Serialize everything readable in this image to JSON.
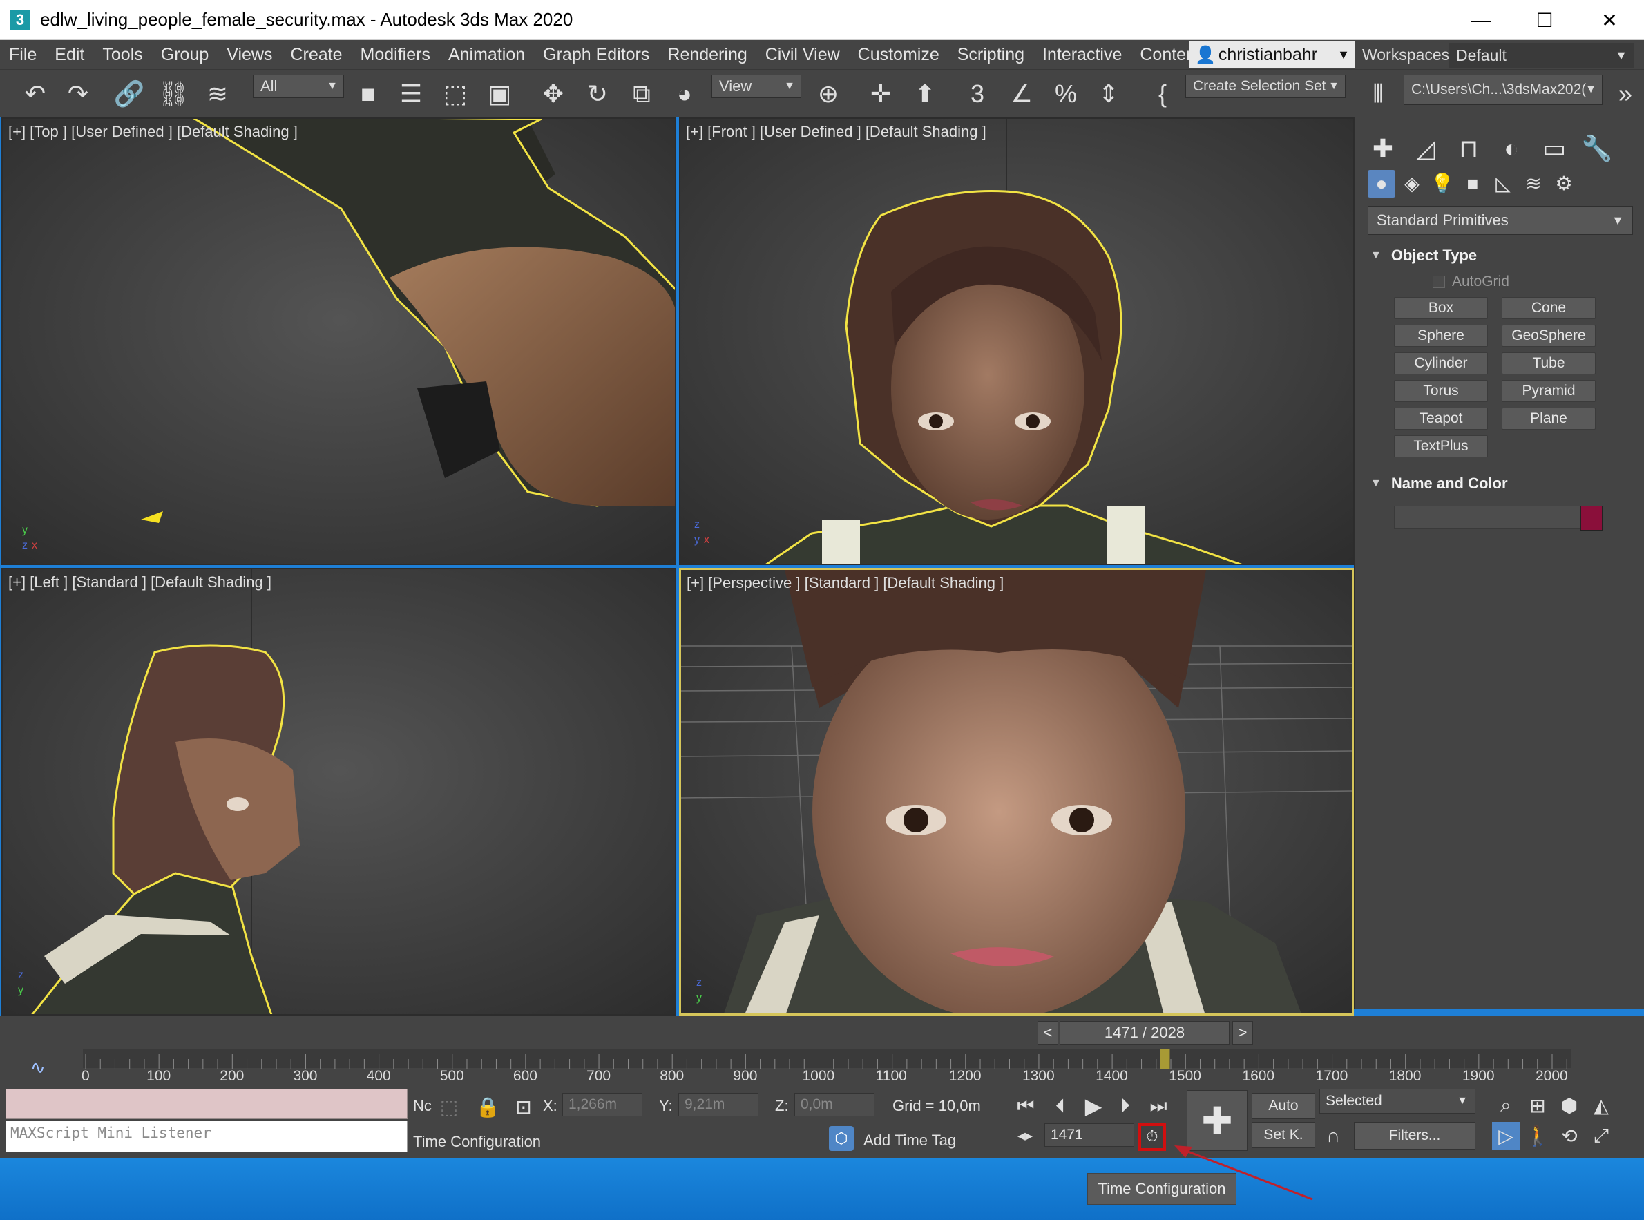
{
  "window": {
    "title": "edlw_living_people_female_security.max - Autodesk 3ds Max 2020",
    "app_icon": "3",
    "minimize": "—",
    "maximize": "☐",
    "close": "✕"
  },
  "menu": {
    "items": [
      "File",
      "Edit",
      "Tools",
      "Group",
      "Views",
      "Create",
      "Modifiers",
      "Animation",
      "Graph Editors",
      "Rendering",
      "Civil View",
      "Customize",
      "Scripting",
      "Interactive",
      "Content"
    ],
    "more": "»",
    "user": "christianbahr",
    "workspaces_label": "Workspaces:",
    "workspace": "Default"
  },
  "toolbar": {
    "selection_filter": "All",
    "ref_coord": "View",
    "create_selection_set": "Create Selection Set",
    "project_path": "C:\\Users\\Ch...\\3dsMax202("
  },
  "viewports": {
    "top_left": "[+] [Top ] [User Defined ] [Default Shading ]",
    "top_right": "[+] [Front ] [User Defined ] [Default Shading ]",
    "bottom_left": "[+] [Left ] [Standard ] [Default Shading ]",
    "bottom_right": "[+] [Perspective ] [Standard ] [Default Shading ]"
  },
  "command_panel": {
    "category": "Standard Primitives",
    "object_type_title": "Object Type",
    "autogrid": "AutoGrid",
    "buttons": [
      "Box",
      "Cone",
      "Sphere",
      "GeoSphere",
      "Cylinder",
      "Tube",
      "Torus",
      "Pyramid",
      "Teapot",
      "Plane",
      "TextPlus"
    ],
    "name_color_title": "Name and Color",
    "color_swatch": "#8a0f3a"
  },
  "timeline": {
    "frame_display": "1471 / 2028",
    "prev": "<",
    "next": ">",
    "ticks": [
      "0",
      "100",
      "200",
      "300",
      "400",
      "500",
      "600",
      "700",
      "800",
      "900",
      "1000",
      "1100",
      "1200",
      "1300",
      "1400",
      "1500",
      "1600",
      "1700",
      "1800",
      "1900",
      "2000"
    ],
    "current_frame": 1471,
    "total_frames": 2028
  },
  "status": {
    "listener": "MAXScript Mini Listener",
    "nc": "Nc",
    "x_label": "X:",
    "x_value": "1,266m",
    "y_label": "Y:",
    "y_value": "9,21m",
    "z_label": "Z:",
    "z_value": "0,0m",
    "grid": "Grid = 10,0m",
    "prompt": "Time Configuration",
    "add_time_tag": "Add Time Tag",
    "frame_field": "1471",
    "auto": "Auto",
    "set_key": "Set K.",
    "selected": "Selected",
    "filters": "Filters..."
  },
  "tooltip": "Time Configuration",
  "colors": {
    "selection_outline": "#f0e040",
    "highlight_box": "#d10f0f",
    "annotation_arrow": "#c0202a"
  }
}
